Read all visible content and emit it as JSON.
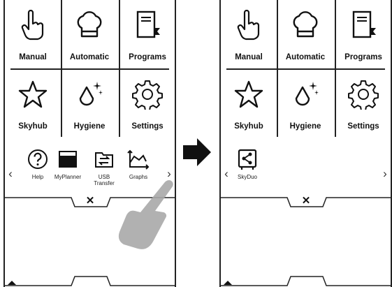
{
  "left_panel": {
    "tiles": [
      {
        "label": "Manual",
        "icon": "hand-pointer-icon"
      },
      {
        "label": "Automatic",
        "icon": "chef-hat-icon"
      },
      {
        "label": "Programs",
        "icon": "book-icon"
      },
      {
        "label": "Skyhub",
        "icon": "star-icon"
      },
      {
        "label": "Hygiene",
        "icon": "drop-sparkle-icon"
      },
      {
        "label": "Settings",
        "icon": "gear-icon"
      }
    ],
    "strip": [
      {
        "label": "Help",
        "icon": "question-icon"
      },
      {
        "label": "MyPlanner",
        "icon": "planner-icon"
      },
      {
        "label": "USB\nTransfer",
        "icon": "usb-transfer-icon"
      },
      {
        "label": "Graphs",
        "icon": "graph-icon"
      }
    ],
    "prev": "‹",
    "next": "›",
    "close": "✕"
  },
  "right_panel": {
    "tiles": [
      {
        "label": "Manual",
        "icon": "hand-pointer-icon"
      },
      {
        "label": "Automatic",
        "icon": "chef-hat-icon"
      },
      {
        "label": "Programs",
        "icon": "book-icon"
      },
      {
        "label": "Skyhub",
        "icon": "star-icon"
      },
      {
        "label": "Hygiene",
        "icon": "drop-sparkle-icon"
      },
      {
        "label": "Settings",
        "icon": "gear-icon"
      }
    ],
    "strip": [
      {
        "label": "SkyDuo",
        "icon": "skyduo-icon"
      }
    ],
    "prev": "‹",
    "next": "›",
    "close": "✕"
  },
  "transition_arrow": "right-arrow-icon",
  "gesture": "swipe-hand-icon"
}
